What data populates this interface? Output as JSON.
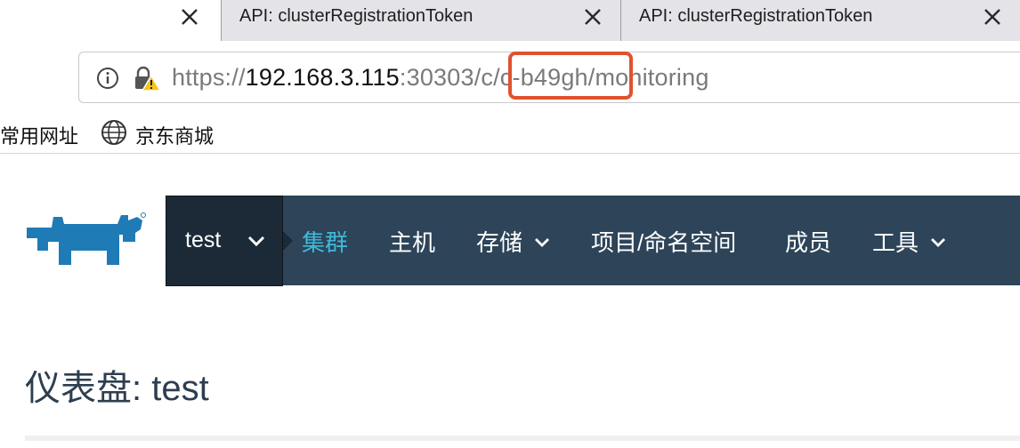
{
  "browser": {
    "tabs": [
      {
        "label": "API: clusterRegistrationToken"
      },
      {
        "label": "API: clusterRegistrationToken"
      }
    ],
    "url": {
      "scheme": "https://",
      "host": "192.168.3.115",
      "port_path": ":30303/c/",
      "highlighted": "c-b49gh/",
      "rest": "monitoring"
    },
    "bookmarks": [
      {
        "label": "常用网址"
      },
      {
        "label": "京东商城",
        "icon": "globe-icon"
      }
    ]
  },
  "app": {
    "cluster": {
      "name": "test"
    },
    "nav": [
      {
        "label": "集群",
        "active": true
      },
      {
        "label": "主机"
      },
      {
        "label": "存储",
        "dropdown": true
      },
      {
        "label": "项目/命名空间"
      },
      {
        "label": "成员"
      },
      {
        "label": "工具",
        "dropdown": true
      }
    ],
    "page_title": "仪表盘: test"
  },
  "colors": {
    "navbar": "#2d4459",
    "cluster_select": "#1c2a38",
    "active_nav": "#3fb9d9",
    "highlight_box": "#e0522f",
    "logo": "#1f7bb6"
  }
}
